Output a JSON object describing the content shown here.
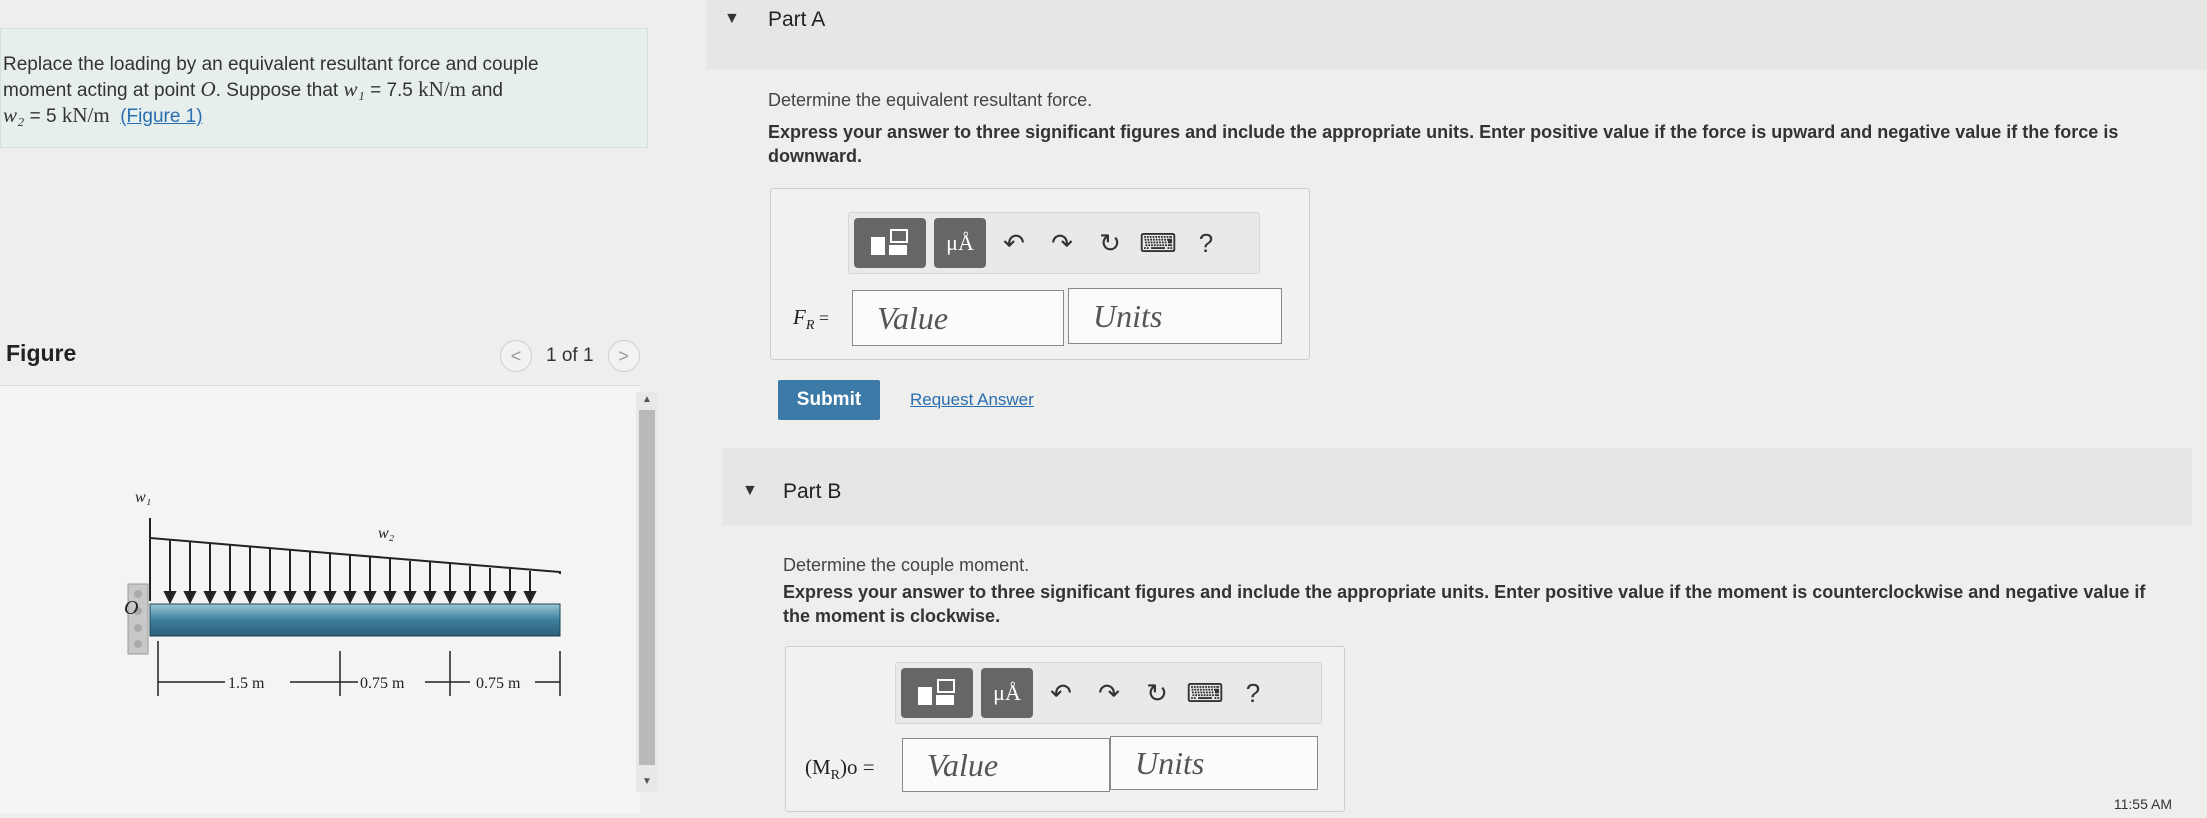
{
  "problem": {
    "line1": "Replace the loading by an equivalent resultant force and couple",
    "line2_a": "moment acting at point ",
    "point": "O",
    "line2_b": ". Suppose that ",
    "w1_sym": "w₁",
    "w1_val": " = 7.5 ",
    "w1_unit": "kN/m",
    "line2_c": " and",
    "w2_sym": "w₂",
    "w2_val": " = 5 ",
    "w2_unit": "kN/m",
    "figure_link": "(Figure 1)"
  },
  "figure": {
    "title": "Figure",
    "pager": "1 of 1",
    "prev": "<",
    "next": ">",
    "labels": {
      "w1": "w₁",
      "w2": "w₂",
      "origin": "O",
      "d1": "1.5 m",
      "d2": "0.75 m",
      "d3": "0.75 m"
    }
  },
  "partA": {
    "label": "Part A",
    "q1": "Determine the equivalent resultant force.",
    "q2": "Express your answer to three significant figures and include the appropriate units. Enter positive value if the force is upward and negative value if the force is downward.",
    "field_label": "F",
    "field_sub": "R",
    "field_eq": " =",
    "value_placeholder": "Value",
    "units_placeholder": "Units",
    "submit": "Submit",
    "request": "Request Answer"
  },
  "partB": {
    "label": "Part B",
    "q1": "Determine the couple moment.",
    "q2": "Express your answer to three significant figures and include the appropriate units. Enter positive value if the moment is counterclockwise and negative value if the moment is clockwise.",
    "field_label": "(M",
    "field_sub": "R",
    "field_tail": ")o =",
    "value_placeholder": "Value",
    "units_placeholder": "Units"
  },
  "toolbar": {
    "mu": "μÅ",
    "help": "?"
  },
  "clock": "11:55 AM",
  "colors": {
    "accent": "#3d7aa8",
    "link": "#2a6db0",
    "problem_bg": "#e6efec",
    "beam": "#3d7f9e"
  }
}
